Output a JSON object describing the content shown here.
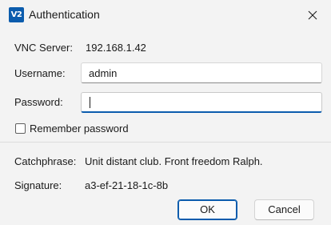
{
  "window": {
    "title": "Authentication",
    "app_icon_text": "V2",
    "accent_color": "#0b5cad"
  },
  "server": {
    "label": "VNC Server:",
    "value": "192.168.1.42"
  },
  "username": {
    "label": "Username:",
    "value": "admin",
    "placeholder": ""
  },
  "password": {
    "label": "Password:",
    "value": "",
    "placeholder": ""
  },
  "remember": {
    "label": "Remember password",
    "checked": false
  },
  "info": {
    "catchphrase_label": "Catchphrase:",
    "catchphrase_value": "Unit distant club. Front freedom Ralph.",
    "signature_label": "Signature:",
    "signature_value": "a3-ef-21-18-1c-8b"
  },
  "buttons": {
    "ok_label": "OK",
    "cancel_label": "Cancel"
  },
  "icons": {
    "app": "vnc-app-icon",
    "close": "close-icon"
  }
}
